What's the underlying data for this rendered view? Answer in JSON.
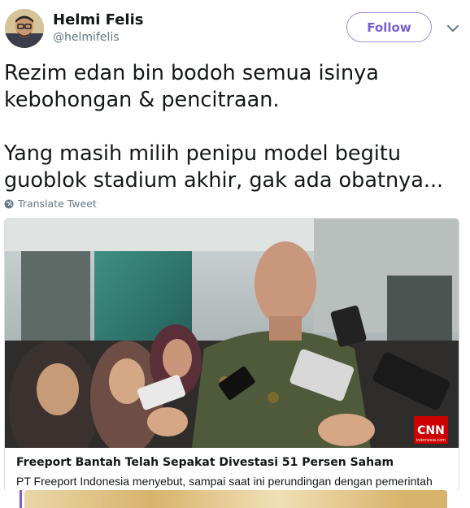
{
  "user": {
    "display_name": "Helmi Felis",
    "handle": "@helmifelis",
    "avatar_icon": "user-avatar-photo"
  },
  "follow_button": {
    "label": "Follow",
    "color": "#7a5fd0"
  },
  "menu_icon": "chevron-down-icon",
  "tweet": {
    "text": "Rezim edan bin bodoh semua isinya\nkebohongan & pencitraan.\n\nYang masih milih penipu model begitu\nguoblok stadium akhir, gak ada obatnya..."
  },
  "translate": {
    "label": "Translate Tweet",
    "icon": "globe-icon"
  },
  "card": {
    "image_icon": "press-conference-photo",
    "watermark": "CNN",
    "watermark_sub": "indonesia.com",
    "title": "Freeport Bantah Telah Sepakat Divestasi 51 Persen Saham",
    "description": "PT Freeport Indonesia menyebut, sampai saat ini perundingan dengan pemerintah"
  }
}
